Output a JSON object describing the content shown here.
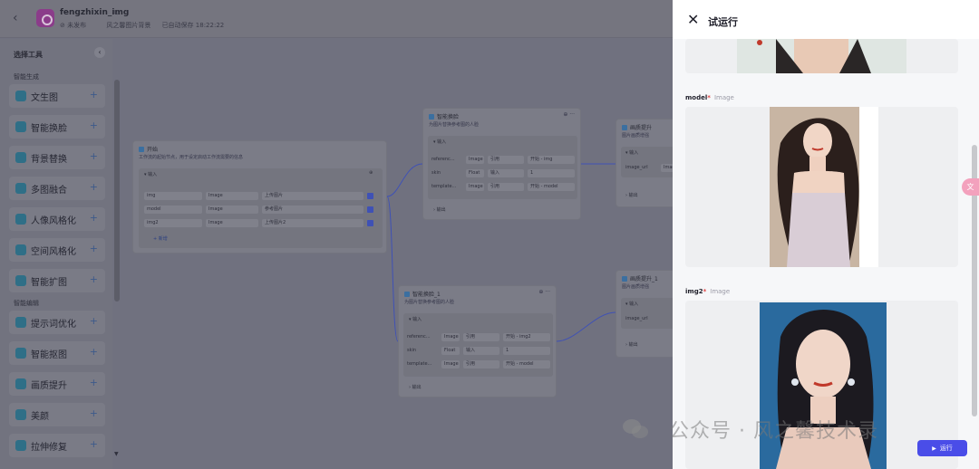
{
  "header": {
    "app_title": "fengzhixin_img",
    "status": "未发布",
    "description": "风之馨图片背景",
    "autosave": "已自动保存 18:22:22"
  },
  "sidebar": {
    "title": "选择工具",
    "section_generate": "智能生成",
    "section_edit": "智能编辑",
    "tools": [
      {
        "label": "文生图"
      },
      {
        "label": "智能换脸"
      },
      {
        "label": "背景替换"
      },
      {
        "label": "多图融合"
      },
      {
        "label": "人像风格化"
      },
      {
        "label": "空间风格化"
      },
      {
        "label": "智能扩图"
      },
      {
        "label": "提示词优化"
      },
      {
        "label": "智能抠图"
      },
      {
        "label": "画质提升"
      },
      {
        "label": "美颜"
      },
      {
        "label": "拉伸修复"
      }
    ]
  },
  "canvas": {
    "start_node": {
      "title": "开始",
      "subtitle": "工作流的起始节点，用于设定启动工作流需要的信息",
      "inputs_label": "输入",
      "add_label": "+ 新增",
      "rows": [
        {
          "name": "img",
          "type": "Image",
          "desc": "上传图片"
        },
        {
          "name": "model",
          "type": "Image",
          "desc": "参考图片"
        },
        {
          "name": "img2",
          "type": "Image",
          "desc": "上传图片2"
        }
      ]
    },
    "swap_node_1": {
      "title": "智能换脸",
      "subtitle": "为图片替换参考图的人脸",
      "inputs_label": "输入",
      "outputs_label": "输出",
      "rows": [
        {
          "name": "referenc...",
          "type": "Image",
          "mode": "引用",
          "value": "开始 - img"
        },
        {
          "name": "skin",
          "type": "Float",
          "mode": "输入",
          "value": "1"
        },
        {
          "name": "template...",
          "type": "Image",
          "mode": "引用",
          "value": "开始 - model"
        }
      ]
    },
    "swap_node_2": {
      "title": "智能换脸_1",
      "subtitle": "为图片替换参考图的人脸",
      "inputs_label": "输入",
      "outputs_label": "输出",
      "rows": [
        {
          "name": "referenc...",
          "type": "Image",
          "mode": "引用",
          "value": "开始 - img2"
        },
        {
          "name": "skin",
          "type": "Float",
          "mode": "输入",
          "value": "1"
        },
        {
          "name": "template...",
          "type": "Image",
          "mode": "引用",
          "value": "开始 - model"
        }
      ]
    },
    "enhance_node_1": {
      "title": "画质提升",
      "subtitle": "图片画质增强",
      "inputs_label": "输入",
      "input_name": "image_url",
      "input_type": "Image",
      "outputs_label": "输出"
    },
    "enhance_node_2": {
      "title": "画质提升_1",
      "subtitle": "图片画质增强",
      "inputs_label": "输入",
      "input_name": "image_url",
      "input_type": "Image",
      "outputs_label": "输出"
    }
  },
  "panel": {
    "title": "试运行",
    "fields": [
      {
        "label": "model",
        "type": "Image"
      },
      {
        "label": "img2",
        "type": "Image"
      }
    ],
    "run_label": "运行"
  },
  "watermark": "公众号 · 风之馨技术录",
  "colors": {
    "accent": "#4a4de8",
    "overlay": "#70717f"
  }
}
